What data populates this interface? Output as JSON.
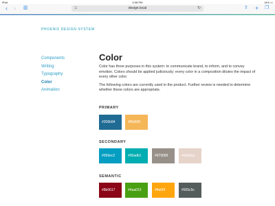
{
  "status_bar": {
    "carrier": "iPad",
    "time": "5:38 PM",
    "battery": "14%"
  },
  "browser": {
    "url": "design.local",
    "icons": {
      "back": "back-arrow-icon",
      "forward": "forward-arrow-icon",
      "bookmarks": "bookmarks-book-icon",
      "reader": "reader-lines-icon",
      "reload": "reload-icon",
      "share": "share-icon",
      "new_tab": "plus-icon",
      "tabs": "tabs-icon"
    }
  },
  "brand": "PHOENIX DESIGN SYSTEM",
  "sidebar": {
    "items": [
      {
        "label": "Components"
      },
      {
        "label": "Writing"
      },
      {
        "label": "Typography"
      },
      {
        "label": "Color"
      },
      {
        "label": "Animation"
      }
    ],
    "active": "Color"
  },
  "main": {
    "title": "Color",
    "paragraph1": "Color has three purposes in this system: to communicate brand, to inform, and to convey emotion. Colors should be applied judiciously; every color in a composition dilutes the impact of every other color.",
    "paragraph2": "The following colors are currently used in the product. Further review is needed to determine whether these colors are appropriate."
  },
  "palettes": {
    "primary": {
      "title": "PRIMARY",
      "swatches": [
        {
          "label": "#206b94",
          "color": "#206b94"
        },
        {
          "label": "#f5b658",
          "color": "#f5b658"
        }
      ]
    },
    "secondary": {
      "title": "SECONDARY",
      "swatches": [
        {
          "label": "#059ec2",
          "color": "#059ec2"
        },
        {
          "label": "#00adb1",
          "color": "#00adb1"
        },
        {
          "label": "#979089",
          "color": "#979089"
        },
        {
          "label": "#e6d3ca",
          "color": "#e6d3ca"
        }
      ]
    },
    "semantic": {
      "title": "SEMANTIC",
      "swatches": [
        {
          "label": "#8b0617",
          "color": "#8b0617"
        },
        {
          "label": "#4aa013",
          "color": "#4aa013"
        },
        {
          "label": "#ffa60f",
          "color": "#ffa60f"
        },
        {
          "label": "#555c5c",
          "color": "#555c5c"
        }
      ]
    }
  }
}
